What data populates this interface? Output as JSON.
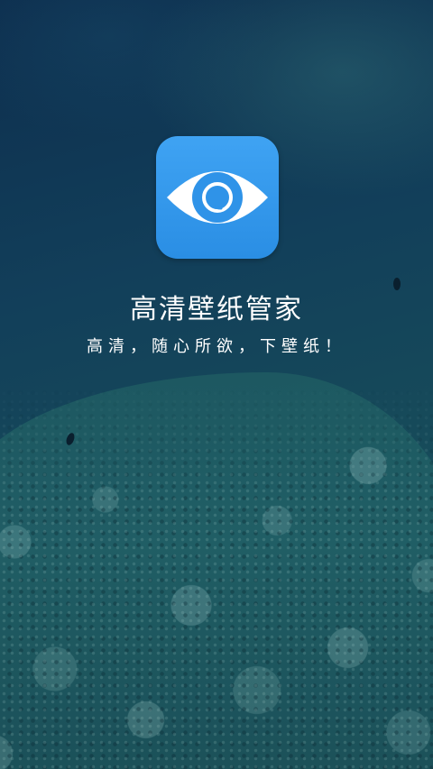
{
  "splash": {
    "icon": "eye-icon",
    "title": "高清壁纸管家",
    "slogan": "高清，随心所欲，下壁纸！"
  },
  "colors": {
    "icon_background": "#3399ee",
    "icon_eye": "#ffffff",
    "text": "#ffffff",
    "background_top": "#0d2e4e",
    "background_bottom": "#1d5560"
  }
}
